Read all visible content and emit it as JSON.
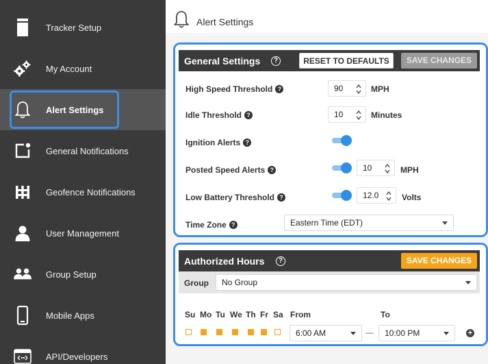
{
  "header": {
    "title": "Alert Settings"
  },
  "sidebar": {
    "items": [
      {
        "label": "Tracker Setup",
        "icon": "tracker-icon"
      },
      {
        "label": "My Account",
        "icon": "gears-icon"
      },
      {
        "label": "Alert Settings",
        "icon": "bell-icon",
        "active": true
      },
      {
        "label": "General Notifications",
        "icon": "notification-icon"
      },
      {
        "label": "Geofence Notifications",
        "icon": "geofence-icon"
      },
      {
        "label": "User Management",
        "icon": "user-icon"
      },
      {
        "label": "Group Setup",
        "icon": "group-icon"
      },
      {
        "label": "Mobile Apps",
        "icon": "phone-icon"
      },
      {
        "label": "API/Developers",
        "icon": "api-icon"
      }
    ]
  },
  "general": {
    "title": "General Settings",
    "reset_label": "RESET TO DEFAULTS",
    "save_label": "SAVE CHANGES",
    "high_speed": {
      "label": "High Speed Threshold",
      "value": "90",
      "unit": "MPH"
    },
    "idle": {
      "label": "Idle Threshold",
      "value": "10",
      "unit": "Minutes"
    },
    "ignition": {
      "label": "Ignition Alerts",
      "enabled": true
    },
    "posted_speed": {
      "label": "Posted Speed Alerts",
      "enabled": true,
      "value": "10",
      "unit": "MPH"
    },
    "low_battery": {
      "label": "Low Battery Threshold",
      "enabled": true,
      "value": "12.0",
      "unit": "Volts"
    },
    "timezone": {
      "label": "Time Zone",
      "value": "Eastern Time (EDT)"
    }
  },
  "authorized": {
    "title": "Authorized Hours",
    "save_label": "SAVE CHANGES",
    "group_label": "Group",
    "group_value": "No Group",
    "days": [
      {
        "label": "Su",
        "checked": false
      },
      {
        "label": "Mo",
        "checked": true
      },
      {
        "label": "Tu",
        "checked": true
      },
      {
        "label": "We",
        "checked": true
      },
      {
        "label": "Th",
        "checked": true
      },
      {
        "label": "Fr",
        "checked": true
      },
      {
        "label": "Sa",
        "checked": false
      }
    ],
    "from_label": "From",
    "from_value": "6:00 AM",
    "to_label": "To",
    "to_value": "10:00 PM",
    "separator": "—"
  },
  "colors": {
    "accent": "#3c8ee6",
    "orange": "#f5a41a",
    "sidebar": "#3a3a3a",
    "toggle_on": "#2f8ee6"
  }
}
